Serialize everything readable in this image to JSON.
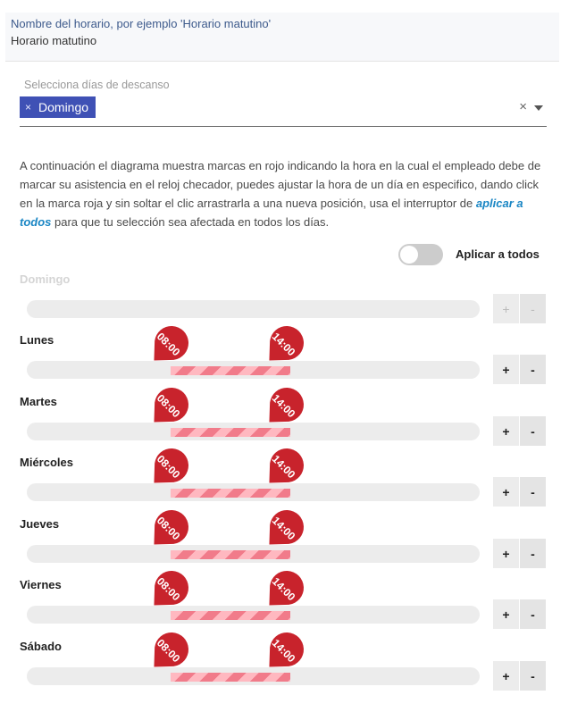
{
  "schedule_name": {
    "label": "Nombre del horario, por ejemplo 'Horario matutino'",
    "value": "Horario matutino"
  },
  "rest_days": {
    "label": "Selecciona días de descanso",
    "chips": [
      {
        "label": "Domingo",
        "remove_icon": "×"
      }
    ],
    "clear_icon": "×"
  },
  "description": {
    "before": "A continuación el diagrama muestra marcas en rojo indicando la hora en la cual el empleado debe de marcar su asistencia en el reloj checador, puedes ajustar la hora de un día en especifico, dando click en la marca roja y sin soltar el clic arrastrarla a una nueva posición, usa el interruptor de ",
    "emphasis": "aplicar a todos",
    "after": " para que tu selección sea afectada en todos los días."
  },
  "apply_all": {
    "label": "Aplicar a todos",
    "checked": false
  },
  "days": [
    {
      "name": "Domingo",
      "disabled": true,
      "marks": []
    },
    {
      "name": "Lunes",
      "disabled": false,
      "marks": [
        "08:00",
        "14:00"
      ]
    },
    {
      "name": "Martes",
      "disabled": false,
      "marks": [
        "08:00",
        "14:00"
      ]
    },
    {
      "name": "Miércoles",
      "disabled": false,
      "marks": [
        "08:00",
        "14:00"
      ]
    },
    {
      "name": "Jueves",
      "disabled": false,
      "marks": [
        "08:00",
        "14:00"
      ]
    },
    {
      "name": "Viernes",
      "disabled": false,
      "marks": [
        "08:00",
        "14:00"
      ]
    },
    {
      "name": "Sábado",
      "disabled": false,
      "marks": [
        "08:00",
        "14:00"
      ]
    }
  ],
  "buttons": {
    "plus": "+",
    "minus": "-"
  },
  "colors": {
    "accent": "#3f51b5",
    "marker": "#c8232c",
    "link": "#1a86c4",
    "range_light": "#ffb8c0",
    "range_dark": "#f17b8a"
  }
}
